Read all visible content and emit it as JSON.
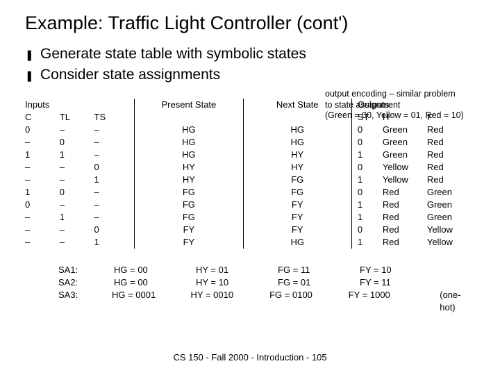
{
  "title": "Example: Traffic Light Controller (cont')",
  "bullets": [
    "Generate state table with symbolic states",
    "Consider state assignments"
  ],
  "side_note": [
    "output encoding – similar problem",
    "to state assignment",
    "(Green = 00, Yellow = 01, Red = 10)"
  ],
  "headers": {
    "inputs_super": "Inputs",
    "inputs": [
      "C",
      "TL",
      "TS"
    ],
    "present": "Present State",
    "next": "Next State",
    "outputs_super": "Outputs",
    "outputs": [
      "ST",
      "H",
      "F"
    ]
  },
  "rows": [
    {
      "c": "0",
      "tl": "–",
      "ts": "–",
      "ps": "HG",
      "ns": "HG",
      "st": "0",
      "h": "Green",
      "f": "Red"
    },
    {
      "c": "–",
      "tl": "0",
      "ts": "–",
      "ps": "HG",
      "ns": "HG",
      "st": "0",
      "h": "Green",
      "f": "Red"
    },
    {
      "c": "1",
      "tl": "1",
      "ts": "–",
      "ps": "HG",
      "ns": "HY",
      "st": "1",
      "h": "Green",
      "f": "Red"
    },
    {
      "c": "–",
      "tl": "–",
      "ts": "0",
      "ps": "HY",
      "ns": "HY",
      "st": "0",
      "h": "Yellow",
      "f": "Red"
    },
    {
      "c": "–",
      "tl": "–",
      "ts": "1",
      "ps": "HY",
      "ns": "FG",
      "st": "1",
      "h": "Yellow",
      "f": "Red"
    },
    {
      "c": "1",
      "tl": "0",
      "ts": "–",
      "ps": "FG",
      "ns": "FG",
      "st": "0",
      "h": "Red",
      "f": "Green"
    },
    {
      "c": "0",
      "tl": "–",
      "ts": "–",
      "ps": "FG",
      "ns": "FY",
      "st": "1",
      "h": "Red",
      "f": "Green"
    },
    {
      "c": "–",
      "tl": "1",
      "ts": "–",
      "ps": "FG",
      "ns": "FY",
      "st": "1",
      "h": "Red",
      "f": "Green"
    },
    {
      "c": "–",
      "tl": "–",
      "ts": "0",
      "ps": "FY",
      "ns": "FY",
      "st": "0",
      "h": "Red",
      "f": "Yellow"
    },
    {
      "c": "–",
      "tl": "–",
      "ts": "1",
      "ps": "FY",
      "ns": "HG",
      "st": "1",
      "h": "Red",
      "f": "Yellow"
    }
  ],
  "assignments": [
    {
      "label": "SA1:",
      "hg": "HG = 00",
      "hy": "HY = 01",
      "fg": "FG = 11",
      "fy": "FY = 10",
      "note": ""
    },
    {
      "label": "SA2:",
      "hg": "HG = 00",
      "hy": "HY = 10",
      "fg": "FG = 01",
      "fy": "FY = 11",
      "note": ""
    },
    {
      "label": "SA3:",
      "hg": "HG = 0001",
      "hy": "HY = 0010",
      "fg": "FG = 0100",
      "fy": "FY = 1000",
      "note": "(one-hot)"
    }
  ],
  "footer": "CS 150 - Fall 2000 - Introduction - 105"
}
